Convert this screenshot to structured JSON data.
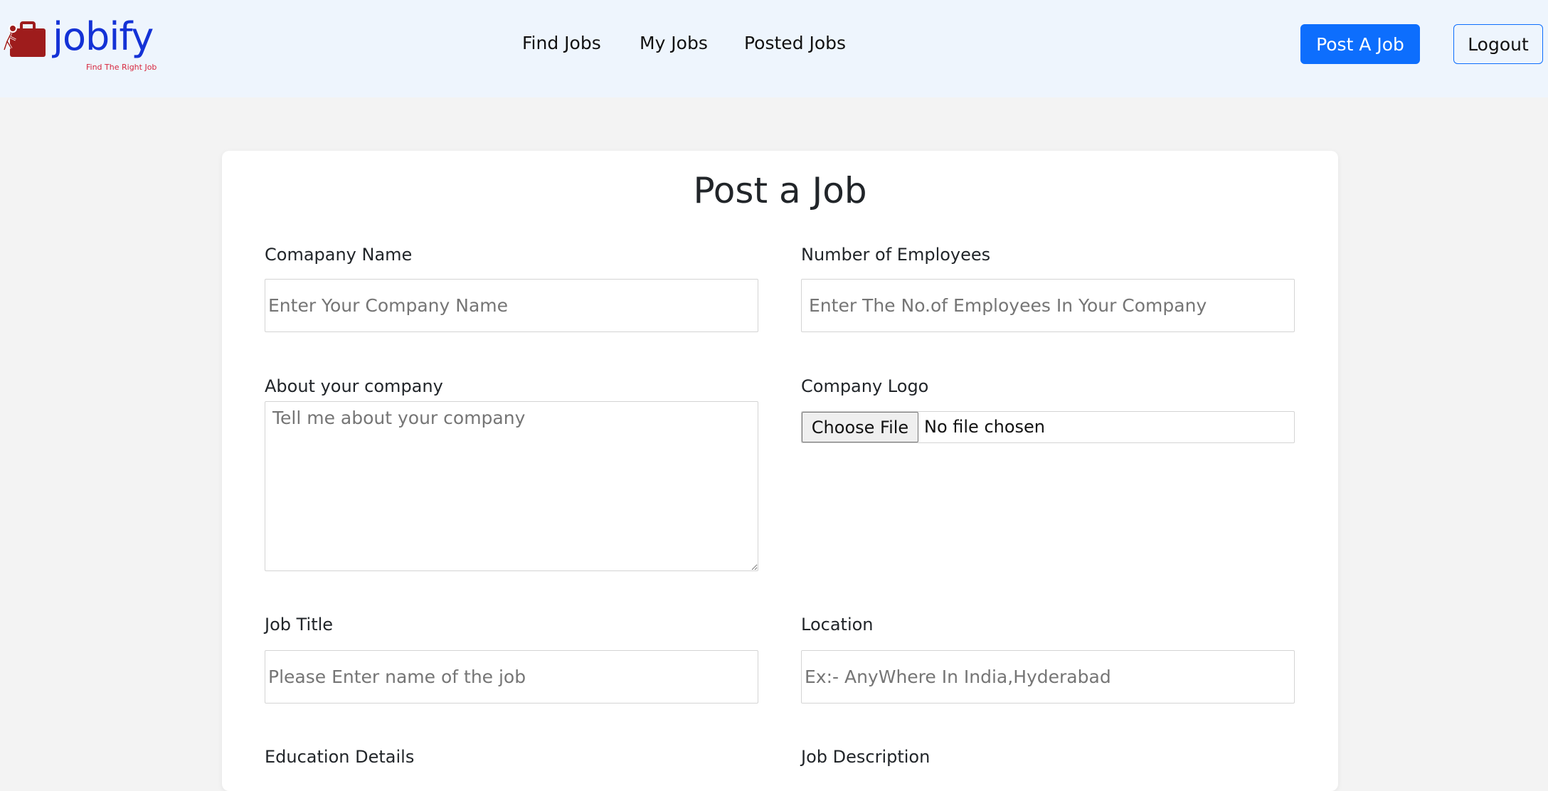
{
  "brand": {
    "name": "jobify",
    "tagline": "Find The Right Job",
    "name_color": "#1432d6",
    "tagline_color": "#d7263d",
    "logo_color": "#9e1c1c"
  },
  "nav": {
    "links": [
      "Find Jobs",
      "My Jobs",
      "Posted Jobs"
    ],
    "post_job_label": "Post A Job",
    "logout_label": "Logout"
  },
  "form": {
    "title": "Post a Job",
    "company_name": {
      "label": "Comapany Name",
      "placeholder": "Enter Your Company Name"
    },
    "employees": {
      "label": "Number of Employees",
      "placeholder": "Enter The No.of Employees In Your Company"
    },
    "about": {
      "label": "About your company",
      "placeholder": "Tell me about your company"
    },
    "logo": {
      "label": "Company Logo",
      "button_label": "Choose File",
      "status": "No file chosen"
    },
    "job_title": {
      "label": "Job Title",
      "placeholder": "Please Enter name of the job"
    },
    "location": {
      "label": "Location",
      "placeholder": "Ex:- AnyWhere In India,Hyderabad"
    },
    "education": {
      "label": "Education Details"
    },
    "description": {
      "label": "Job Description"
    }
  },
  "colors": {
    "primary": "#0d6efd",
    "navbar_bg": "#eef5fd",
    "page_bg": "#f3f3f3"
  }
}
